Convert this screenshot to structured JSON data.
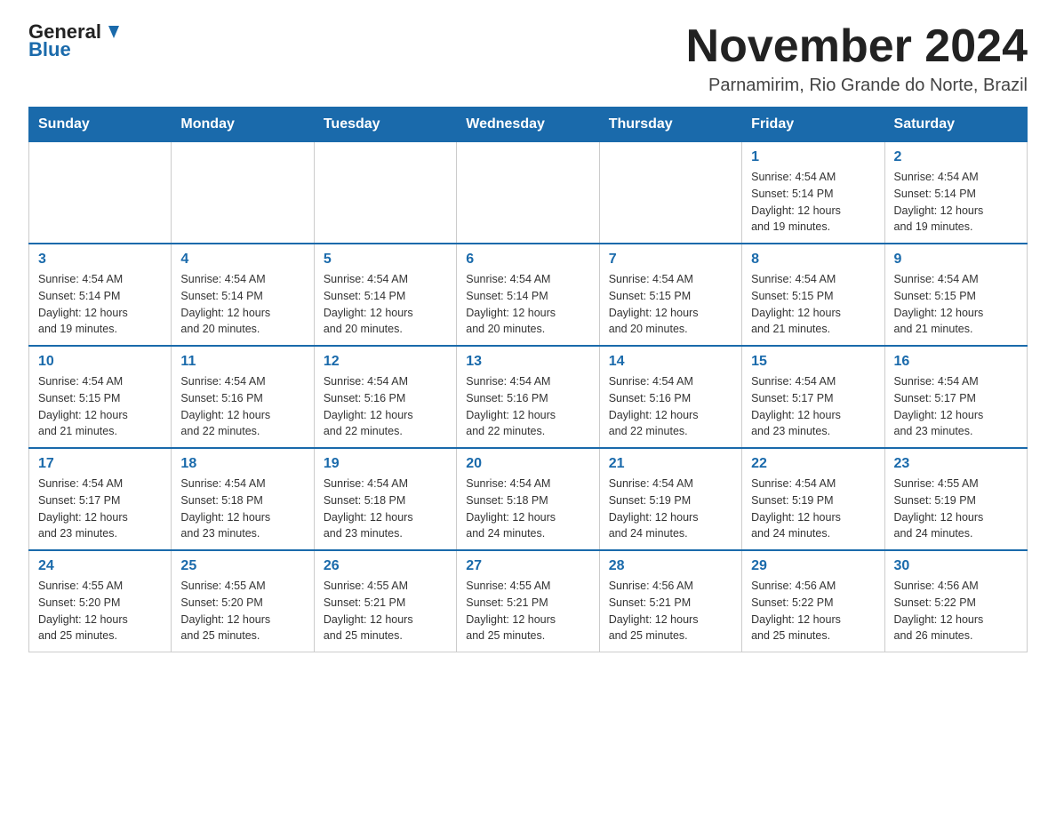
{
  "header": {
    "logo_general": "General",
    "logo_blue": "Blue",
    "month_title": "November 2024",
    "location": "Parnamirim, Rio Grande do Norte, Brazil"
  },
  "days_of_week": [
    "Sunday",
    "Monday",
    "Tuesday",
    "Wednesday",
    "Thursday",
    "Friday",
    "Saturday"
  ],
  "weeks": [
    [
      {
        "day": "",
        "info": ""
      },
      {
        "day": "",
        "info": ""
      },
      {
        "day": "",
        "info": ""
      },
      {
        "day": "",
        "info": ""
      },
      {
        "day": "",
        "info": ""
      },
      {
        "day": "1",
        "info": "Sunrise: 4:54 AM\nSunset: 5:14 PM\nDaylight: 12 hours\nand 19 minutes."
      },
      {
        "day": "2",
        "info": "Sunrise: 4:54 AM\nSunset: 5:14 PM\nDaylight: 12 hours\nand 19 minutes."
      }
    ],
    [
      {
        "day": "3",
        "info": "Sunrise: 4:54 AM\nSunset: 5:14 PM\nDaylight: 12 hours\nand 19 minutes."
      },
      {
        "day": "4",
        "info": "Sunrise: 4:54 AM\nSunset: 5:14 PM\nDaylight: 12 hours\nand 20 minutes."
      },
      {
        "day": "5",
        "info": "Sunrise: 4:54 AM\nSunset: 5:14 PM\nDaylight: 12 hours\nand 20 minutes."
      },
      {
        "day": "6",
        "info": "Sunrise: 4:54 AM\nSunset: 5:14 PM\nDaylight: 12 hours\nand 20 minutes."
      },
      {
        "day": "7",
        "info": "Sunrise: 4:54 AM\nSunset: 5:15 PM\nDaylight: 12 hours\nand 20 minutes."
      },
      {
        "day": "8",
        "info": "Sunrise: 4:54 AM\nSunset: 5:15 PM\nDaylight: 12 hours\nand 21 minutes."
      },
      {
        "day": "9",
        "info": "Sunrise: 4:54 AM\nSunset: 5:15 PM\nDaylight: 12 hours\nand 21 minutes."
      }
    ],
    [
      {
        "day": "10",
        "info": "Sunrise: 4:54 AM\nSunset: 5:15 PM\nDaylight: 12 hours\nand 21 minutes."
      },
      {
        "day": "11",
        "info": "Sunrise: 4:54 AM\nSunset: 5:16 PM\nDaylight: 12 hours\nand 22 minutes."
      },
      {
        "day": "12",
        "info": "Sunrise: 4:54 AM\nSunset: 5:16 PM\nDaylight: 12 hours\nand 22 minutes."
      },
      {
        "day": "13",
        "info": "Sunrise: 4:54 AM\nSunset: 5:16 PM\nDaylight: 12 hours\nand 22 minutes."
      },
      {
        "day": "14",
        "info": "Sunrise: 4:54 AM\nSunset: 5:16 PM\nDaylight: 12 hours\nand 22 minutes."
      },
      {
        "day": "15",
        "info": "Sunrise: 4:54 AM\nSunset: 5:17 PM\nDaylight: 12 hours\nand 23 minutes."
      },
      {
        "day": "16",
        "info": "Sunrise: 4:54 AM\nSunset: 5:17 PM\nDaylight: 12 hours\nand 23 minutes."
      }
    ],
    [
      {
        "day": "17",
        "info": "Sunrise: 4:54 AM\nSunset: 5:17 PM\nDaylight: 12 hours\nand 23 minutes."
      },
      {
        "day": "18",
        "info": "Sunrise: 4:54 AM\nSunset: 5:18 PM\nDaylight: 12 hours\nand 23 minutes."
      },
      {
        "day": "19",
        "info": "Sunrise: 4:54 AM\nSunset: 5:18 PM\nDaylight: 12 hours\nand 23 minutes."
      },
      {
        "day": "20",
        "info": "Sunrise: 4:54 AM\nSunset: 5:18 PM\nDaylight: 12 hours\nand 24 minutes."
      },
      {
        "day": "21",
        "info": "Sunrise: 4:54 AM\nSunset: 5:19 PM\nDaylight: 12 hours\nand 24 minutes."
      },
      {
        "day": "22",
        "info": "Sunrise: 4:54 AM\nSunset: 5:19 PM\nDaylight: 12 hours\nand 24 minutes."
      },
      {
        "day": "23",
        "info": "Sunrise: 4:55 AM\nSunset: 5:19 PM\nDaylight: 12 hours\nand 24 minutes."
      }
    ],
    [
      {
        "day": "24",
        "info": "Sunrise: 4:55 AM\nSunset: 5:20 PM\nDaylight: 12 hours\nand 25 minutes."
      },
      {
        "day": "25",
        "info": "Sunrise: 4:55 AM\nSunset: 5:20 PM\nDaylight: 12 hours\nand 25 minutes."
      },
      {
        "day": "26",
        "info": "Sunrise: 4:55 AM\nSunset: 5:21 PM\nDaylight: 12 hours\nand 25 minutes."
      },
      {
        "day": "27",
        "info": "Sunrise: 4:55 AM\nSunset: 5:21 PM\nDaylight: 12 hours\nand 25 minutes."
      },
      {
        "day": "28",
        "info": "Sunrise: 4:56 AM\nSunset: 5:21 PM\nDaylight: 12 hours\nand 25 minutes."
      },
      {
        "day": "29",
        "info": "Sunrise: 4:56 AM\nSunset: 5:22 PM\nDaylight: 12 hours\nand 25 minutes."
      },
      {
        "day": "30",
        "info": "Sunrise: 4:56 AM\nSunset: 5:22 PM\nDaylight: 12 hours\nand 26 minutes."
      }
    ]
  ]
}
